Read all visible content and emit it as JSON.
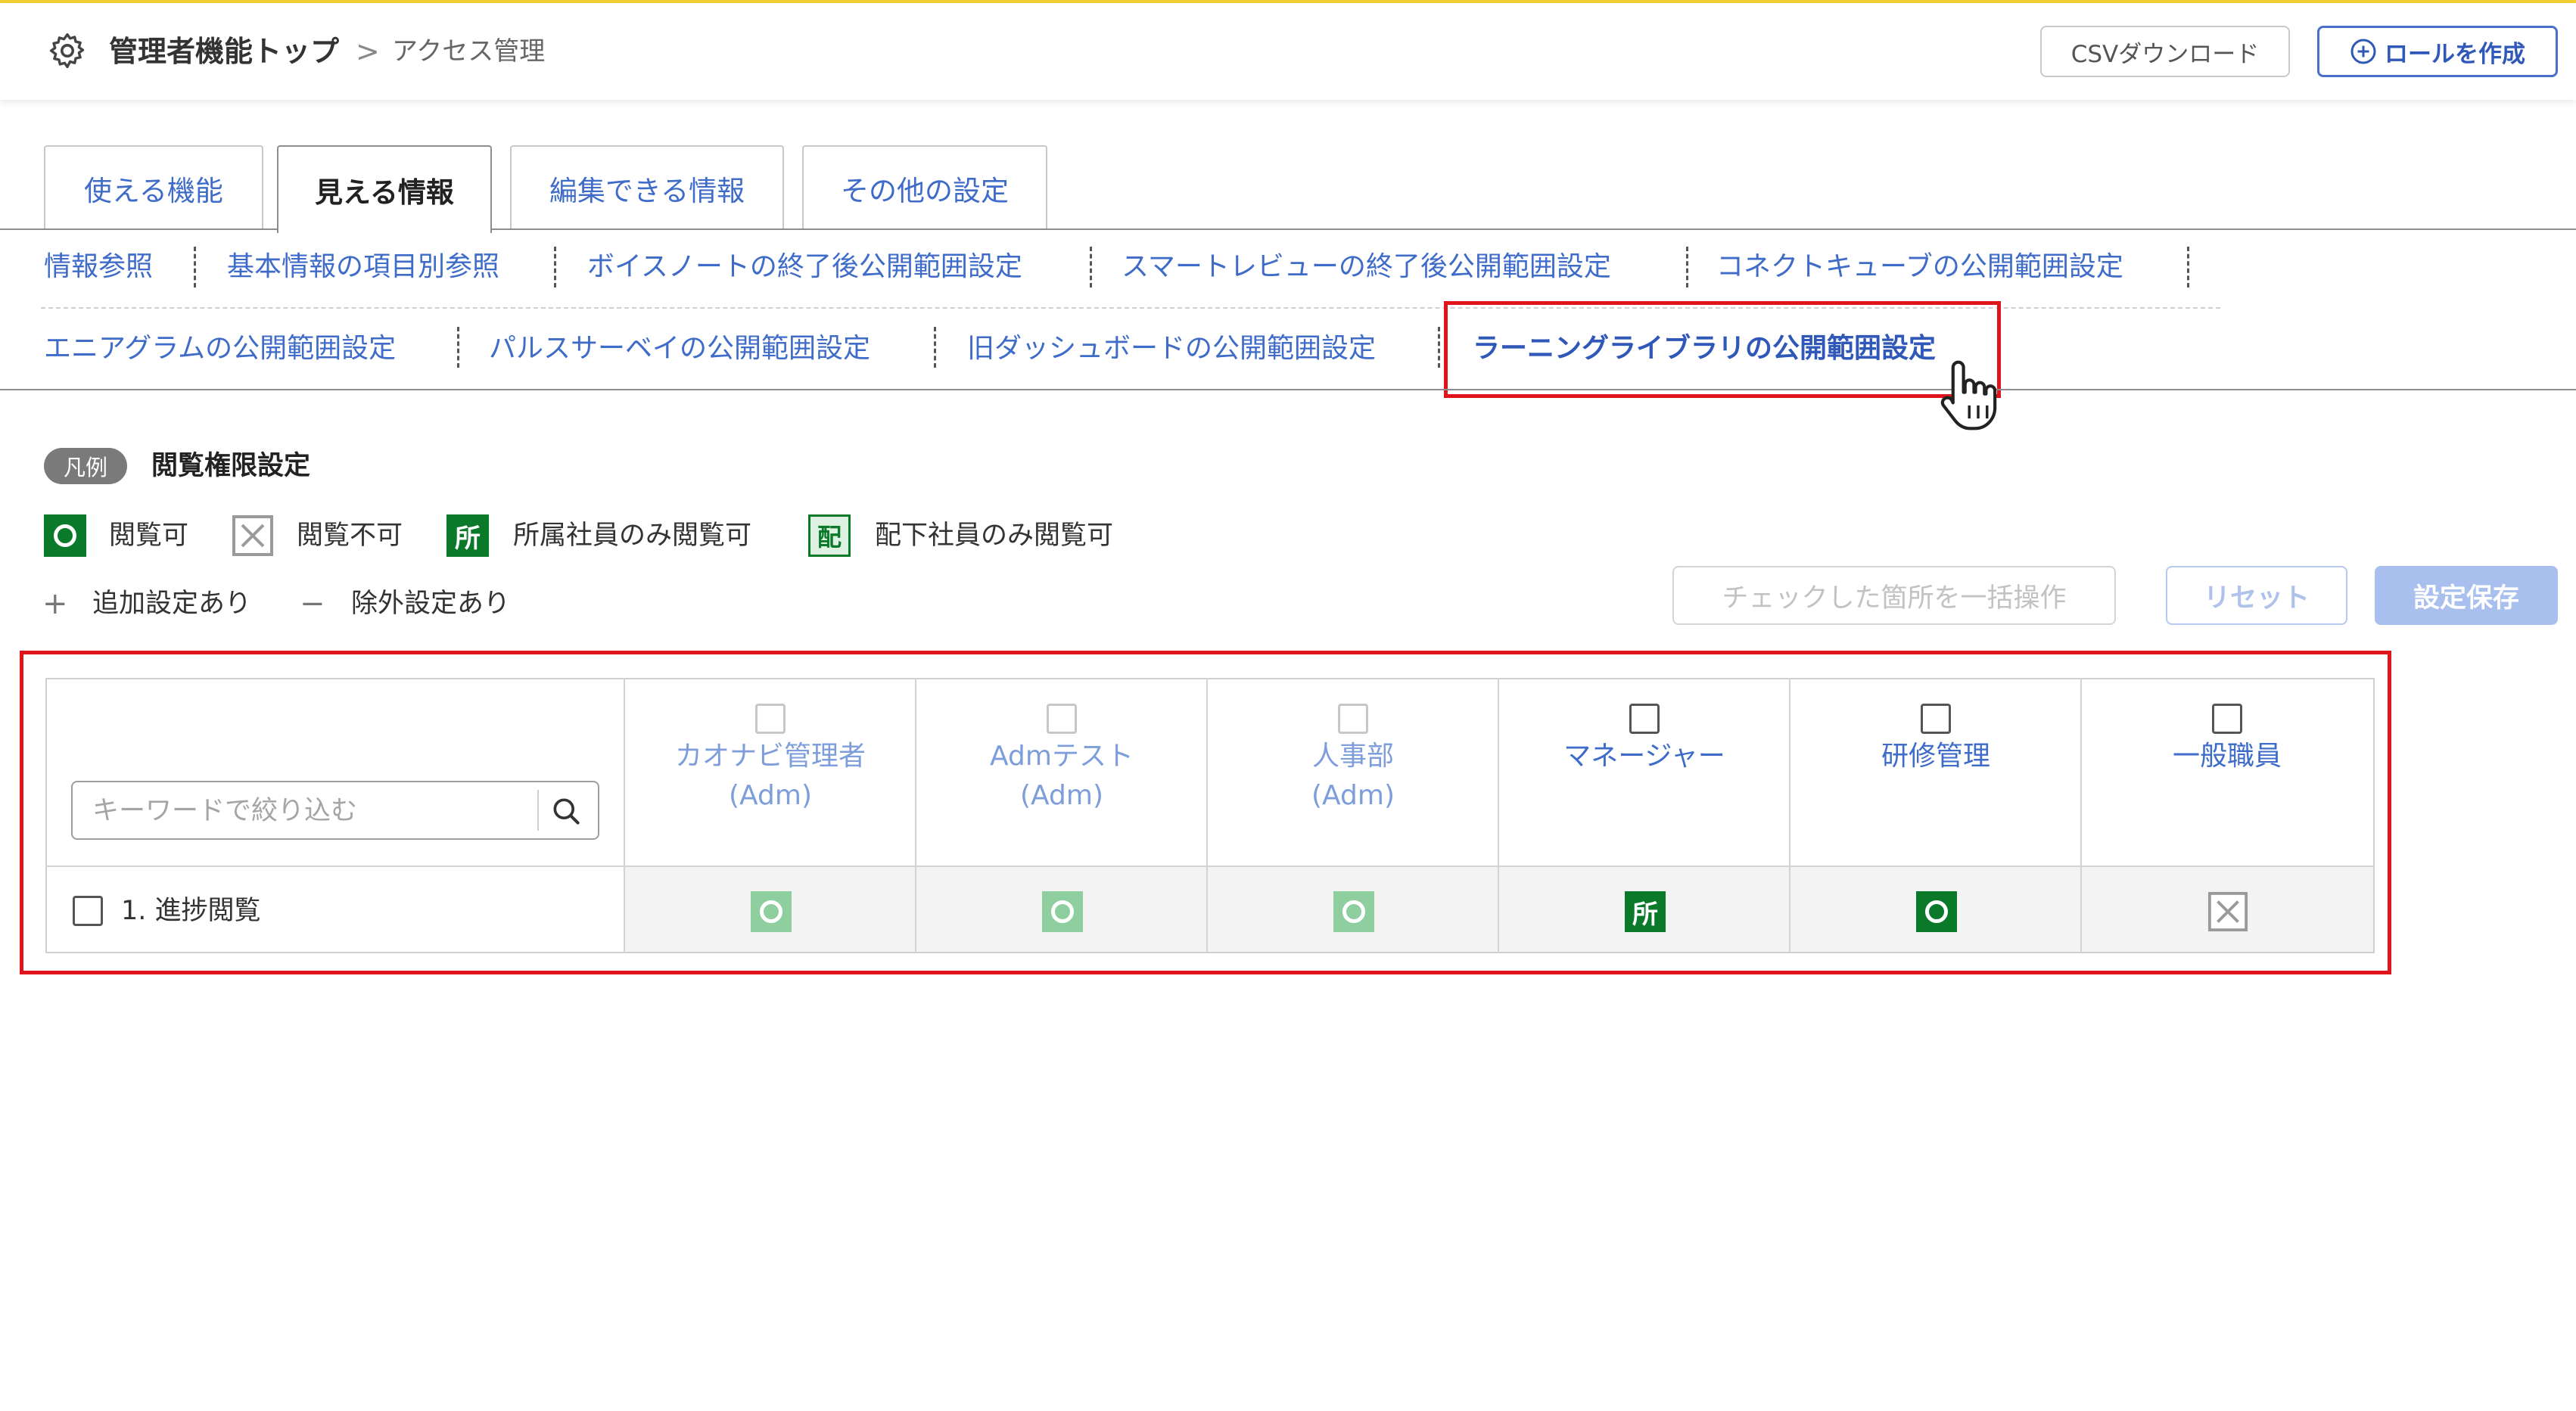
{
  "header": {
    "breadcrumb_root": "管理者機能トップ",
    "breadcrumb_separator": ">",
    "breadcrumb_current": "アクセス管理",
    "csv_button": "CSVダウンロード",
    "create_role_button": "ロールを作成"
  },
  "tabs": [
    {
      "label": "使える機能",
      "active": false
    },
    {
      "label": "見える情報",
      "active": true
    },
    {
      "label": "編集できる情報",
      "active": false
    },
    {
      "label": "その他の設定",
      "active": false
    }
  ],
  "subtabs": [
    {
      "label": "情報参照",
      "active": false
    },
    {
      "label": "基本情報の項目別参照",
      "active": false
    },
    {
      "label": "ボイスノートの終了後公開範囲設定",
      "active": false
    },
    {
      "label": "スマートレビューの終了後公開範囲設定",
      "active": false
    },
    {
      "label": "コネクトキューブの公開範囲設定",
      "active": false
    },
    {
      "label": "エニアグラムの公開範囲設定",
      "active": false
    },
    {
      "label": "パルスサーベイの公開範囲設定",
      "active": false
    },
    {
      "label": "旧ダッシュボードの公開範囲設定",
      "active": false
    },
    {
      "label": "ラーニングライブラリの公開範囲設定",
      "active": true
    }
  ],
  "legend": {
    "tag": "凡例",
    "title": "閲覧権限設定",
    "items": [
      {
        "icon": "circle-ok-icon",
        "label": "閲覧可"
      },
      {
        "icon": "x-box-icon",
        "label": "閲覧不可"
      },
      {
        "icon": "sho-badge-icon",
        "glyph": "所",
        "label": "所属社員のみ閲覧可"
      },
      {
        "icon": "hai-badge-icon",
        "glyph": "配",
        "label": "配下社員のみ閲覧可"
      }
    ],
    "plus_symbol": "+",
    "plus_label": "追加設定あり",
    "minus_symbol": "−",
    "minus_label": "除外設定あり"
  },
  "actions": {
    "bulk": "チェックした箇所を一括操作",
    "reset": "リセット",
    "save": "設定保存"
  },
  "table": {
    "search_placeholder": "キーワードで絞り込む",
    "columns": [
      {
        "name": "カオナビ管理者",
        "sub": "(Adm)"
      },
      {
        "name": "Admテスト",
        "sub": "(Adm)"
      },
      {
        "name": "人事部",
        "sub": "(Adm)"
      },
      {
        "name": "マネージャー",
        "sub": ""
      },
      {
        "name": "研修管理",
        "sub": ""
      },
      {
        "name": "一般職員",
        "sub": ""
      }
    ],
    "rows": [
      {
        "label": "1. 進捗閲覧",
        "cells": [
          "view-allowed-inherited",
          "view-allowed-inherited",
          "view-allowed-inherited",
          "affiliated-only",
          "view-allowed",
          "view-denied"
        ],
        "cell_glyphs": [
          "",
          "",
          "",
          "所",
          "",
          ""
        ]
      }
    ]
  },
  "colors": {
    "accent": "#3f6cc8",
    "highlight": "#e0151b",
    "green": "#0a7a2a",
    "top_bar": "#f3cd34"
  }
}
